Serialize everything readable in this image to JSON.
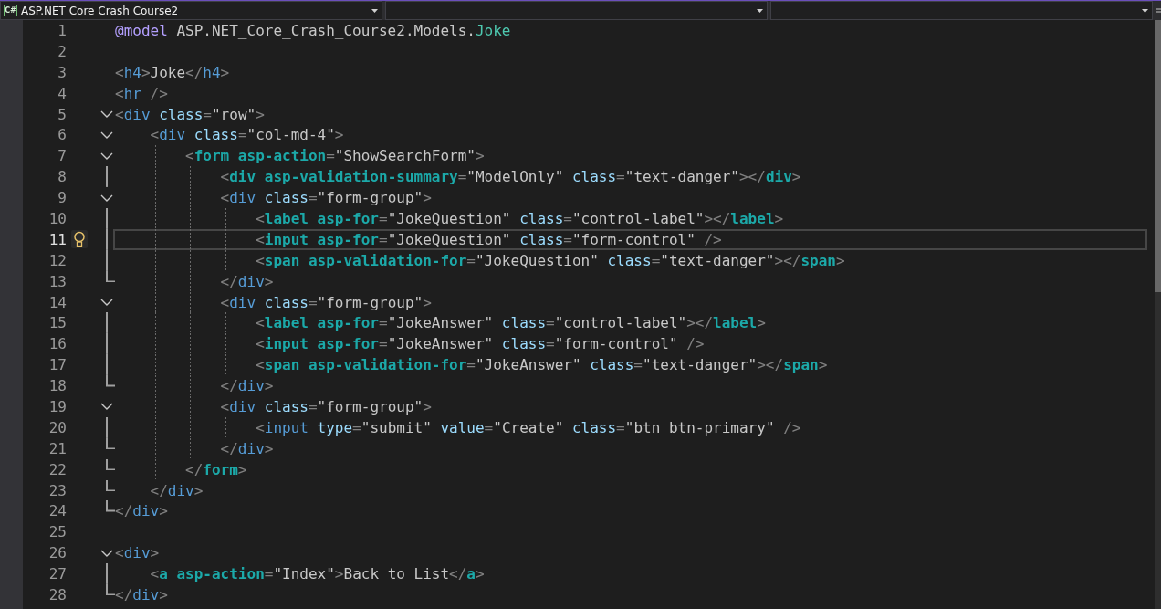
{
  "navbar": {
    "project_dropdown": {
      "icon_label": "C#",
      "text": "ASP.NET Core Crash Course2"
    }
  },
  "lines": [
    {
      "number": "1",
      "kind": "plain",
      "selected": false,
      "hint": false,
      "tokens": [
        {
          "kind": "k",
          "text": "@model"
        },
        {
          "kind": "v",
          "text": " ASP.NET_Core_Crash_Course2.Models."
        },
        {
          "kind": "y",
          "text": "Joke"
        }
      ]
    },
    {
      "number": "2",
      "kind": "plain",
      "selected": false,
      "hint": false
    },
    {
      "number": "3",
      "kind": "plain",
      "selected": false,
      "hint": false,
      "tokens": [
        {
          "kind": "p",
          "text": "<"
        },
        {
          "kind": "t",
          "text": "h4"
        },
        {
          "kind": "p",
          "text": ">"
        },
        {
          "kind": "v",
          "text": "Joke"
        },
        {
          "kind": "p",
          "text": "</"
        },
        {
          "kind": "t",
          "text": "h4"
        },
        {
          "kind": "p",
          "text": ">"
        }
      ]
    },
    {
      "number": "4",
      "kind": "plain",
      "selected": false,
      "hint": false,
      "tokens": [
        {
          "kind": "p",
          "text": "<"
        },
        {
          "kind": "t",
          "text": "hr"
        },
        {
          "kind": "p",
          "text": " />"
        }
      ]
    },
    {
      "number": "5",
      "kind": "opener",
      "selected": false,
      "hint": false,
      "tokens": [
        {
          "kind": "p",
          "text": "<"
        },
        {
          "kind": "t",
          "text": "div"
        },
        {
          "kind": "a",
          "text": " class"
        },
        {
          "kind": "p",
          "text": "="
        },
        {
          "kind": "v",
          "text": "\"row\""
        },
        {
          "kind": "p",
          "text": ">"
        }
      ]
    },
    {
      "number": "6",
      "kind": "opener",
      "selected": false,
      "hint": false,
      "tokens": [
        {
          "kind": "p",
          "text": "    <"
        },
        {
          "kind": "t",
          "text": "div"
        },
        {
          "kind": "a",
          "text": " class"
        },
        {
          "kind": "p",
          "text": "="
        },
        {
          "kind": "v",
          "text": "\"col-md-4\""
        },
        {
          "kind": "p",
          "text": ">"
        }
      ]
    },
    {
      "number": "7",
      "kind": "opener",
      "selected": false,
      "hint": false,
      "tokens": [
        {
          "kind": "p",
          "text": "        <"
        },
        {
          "kind": "h",
          "text": "form"
        },
        {
          "kind": "h",
          "text": " asp-action"
        },
        {
          "kind": "p",
          "text": "="
        },
        {
          "kind": "v",
          "text": "\"ShowSearchForm\""
        },
        {
          "kind": "p",
          "text": ">"
        }
      ]
    },
    {
      "number": "8",
      "kind": "inner",
      "selected": false,
      "hint": false,
      "tokens": [
        {
          "kind": "p",
          "text": "            <"
        },
        {
          "kind": "h",
          "text": "div"
        },
        {
          "kind": "h",
          "text": " asp-validation-summary"
        },
        {
          "kind": "p",
          "text": "="
        },
        {
          "kind": "v",
          "text": "\"ModelOnly\""
        },
        {
          "kind": "a",
          "text": " class"
        },
        {
          "kind": "p",
          "text": "="
        },
        {
          "kind": "v",
          "text": "\"text-danger\""
        },
        {
          "kind": "p",
          "text": "></"
        },
        {
          "kind": "h",
          "text": "div"
        },
        {
          "kind": "p",
          "text": ">"
        }
      ]
    },
    {
      "number": "9",
      "kind": "opener",
      "selected": false,
      "hint": false,
      "tokens": [
        {
          "kind": "p",
          "text": "            <"
        },
        {
          "kind": "t",
          "text": "div"
        },
        {
          "kind": "a",
          "text": " class"
        },
        {
          "kind": "p",
          "text": "="
        },
        {
          "kind": "v",
          "text": "\"form-group\""
        },
        {
          "kind": "p",
          "text": ">"
        }
      ]
    },
    {
      "number": "10",
      "kind": "inner",
      "selected": false,
      "hint": false,
      "tokens": [
        {
          "kind": "p",
          "text": "                <"
        },
        {
          "kind": "h",
          "text": "label"
        },
        {
          "kind": "h",
          "text": " asp-for"
        },
        {
          "kind": "p",
          "text": "="
        },
        {
          "kind": "v",
          "text": "\"JokeQuestion\""
        },
        {
          "kind": "a",
          "text": " class"
        },
        {
          "kind": "p",
          "text": "="
        },
        {
          "kind": "v",
          "text": "\"control-label\""
        },
        {
          "kind": "p",
          "text": "></"
        },
        {
          "kind": "h",
          "text": "label"
        },
        {
          "kind": "p",
          "text": ">"
        }
      ]
    },
    {
      "number": "11",
      "kind": "inner",
      "selected": true,
      "hint": true,
      "tokens": [
        {
          "kind": "p",
          "text": "                <"
        },
        {
          "kind": "h",
          "text": "input"
        },
        {
          "kind": "h",
          "text": " asp-for"
        },
        {
          "kind": "p",
          "text": "="
        },
        {
          "kind": "v",
          "text": "\"JokeQuestion\""
        },
        {
          "kind": "a",
          "text": " class"
        },
        {
          "kind": "p",
          "text": "="
        },
        {
          "kind": "v",
          "text": "\"form-control\""
        },
        {
          "kind": "p",
          "text": " />"
        }
      ]
    },
    {
      "number": "12",
      "kind": "inner",
      "selected": false,
      "hint": false,
      "tokens": [
        {
          "kind": "p",
          "text": "                <"
        },
        {
          "kind": "h",
          "text": "span"
        },
        {
          "kind": "h",
          "text": " asp-validation-for"
        },
        {
          "kind": "p",
          "text": "="
        },
        {
          "kind": "v",
          "text": "\"JokeQuestion\""
        },
        {
          "kind": "a",
          "text": " class"
        },
        {
          "kind": "p",
          "text": "="
        },
        {
          "kind": "v",
          "text": "\"text-danger\""
        },
        {
          "kind": "p",
          "text": "></"
        },
        {
          "kind": "h",
          "text": "span"
        },
        {
          "kind": "p",
          "text": ">"
        }
      ]
    },
    {
      "number": "13",
      "kind": "closer",
      "selected": false,
      "hint": false,
      "tokens": [
        {
          "kind": "p",
          "text": "            </"
        },
        {
          "kind": "t",
          "text": "div"
        },
        {
          "kind": "p",
          "text": ">"
        }
      ]
    },
    {
      "number": "14",
      "kind": "opener",
      "selected": false,
      "hint": false,
      "tokens": [
        {
          "kind": "p",
          "text": "            <"
        },
        {
          "kind": "t",
          "text": "div"
        },
        {
          "kind": "a",
          "text": " class"
        },
        {
          "kind": "p",
          "text": "="
        },
        {
          "kind": "v",
          "text": "\"form-group\""
        },
        {
          "kind": "p",
          "text": ">"
        }
      ]
    },
    {
      "number": "15",
      "kind": "inner",
      "selected": false,
      "hint": false,
      "tokens": [
        {
          "kind": "p",
          "text": "                <"
        },
        {
          "kind": "h",
          "text": "label"
        },
        {
          "kind": "h",
          "text": " asp-for"
        },
        {
          "kind": "p",
          "text": "="
        },
        {
          "kind": "v",
          "text": "\"JokeAnswer\""
        },
        {
          "kind": "a",
          "text": " class"
        },
        {
          "kind": "p",
          "text": "="
        },
        {
          "kind": "v",
          "text": "\"control-label\""
        },
        {
          "kind": "p",
          "text": "></"
        },
        {
          "kind": "h",
          "text": "label"
        },
        {
          "kind": "p",
          "text": ">"
        }
      ]
    },
    {
      "number": "16",
      "kind": "inner",
      "selected": false,
      "hint": false,
      "tokens": [
        {
          "kind": "p",
          "text": "                <"
        },
        {
          "kind": "h",
          "text": "input"
        },
        {
          "kind": "h",
          "text": " asp-for"
        },
        {
          "kind": "p",
          "text": "="
        },
        {
          "kind": "v",
          "text": "\"JokeAnswer\""
        },
        {
          "kind": "a",
          "text": " class"
        },
        {
          "kind": "p",
          "text": "="
        },
        {
          "kind": "v",
          "text": "\"form-control\""
        },
        {
          "kind": "p",
          "text": " />"
        }
      ]
    },
    {
      "number": "17",
      "kind": "inner",
      "selected": false,
      "hint": false,
      "tokens": [
        {
          "kind": "p",
          "text": "                <"
        },
        {
          "kind": "h",
          "text": "span"
        },
        {
          "kind": "h",
          "text": " asp-validation-for"
        },
        {
          "kind": "p",
          "text": "="
        },
        {
          "kind": "v",
          "text": "\"JokeAnswer\""
        },
        {
          "kind": "a",
          "text": " class"
        },
        {
          "kind": "p",
          "text": "="
        },
        {
          "kind": "v",
          "text": "\"text-danger\""
        },
        {
          "kind": "p",
          "text": "></"
        },
        {
          "kind": "h",
          "text": "span"
        },
        {
          "kind": "p",
          "text": ">"
        }
      ]
    },
    {
      "number": "18",
      "kind": "closer",
      "selected": false,
      "hint": false,
      "tokens": [
        {
          "kind": "p",
          "text": "            </"
        },
        {
          "kind": "t",
          "text": "div"
        },
        {
          "kind": "p",
          "text": ">"
        }
      ]
    },
    {
      "number": "19",
      "kind": "opener",
      "selected": false,
      "hint": false,
      "tokens": [
        {
          "kind": "p",
          "text": "            <"
        },
        {
          "kind": "t",
          "text": "div"
        },
        {
          "kind": "a",
          "text": " class"
        },
        {
          "kind": "p",
          "text": "="
        },
        {
          "kind": "v",
          "text": "\"form-group\""
        },
        {
          "kind": "p",
          "text": ">"
        }
      ]
    },
    {
      "number": "20",
      "kind": "inner",
      "selected": false,
      "hint": false,
      "tokens": [
        {
          "kind": "p",
          "text": "                <"
        },
        {
          "kind": "t",
          "text": "input"
        },
        {
          "kind": "a",
          "text": " type"
        },
        {
          "kind": "p",
          "text": "="
        },
        {
          "kind": "v",
          "text": "\"submit\""
        },
        {
          "kind": "a",
          "text": " value"
        },
        {
          "kind": "p",
          "text": "="
        },
        {
          "kind": "v",
          "text": "\"Create\""
        },
        {
          "kind": "a",
          "text": " class"
        },
        {
          "kind": "p",
          "text": "="
        },
        {
          "kind": "v",
          "text": "\"btn btn-primary\""
        },
        {
          "kind": "p",
          "text": " />"
        }
      ]
    },
    {
      "number": "21",
      "kind": "closer",
      "selected": false,
      "hint": false,
      "tokens": [
        {
          "kind": "p",
          "text": "            </"
        },
        {
          "kind": "t",
          "text": "div"
        },
        {
          "kind": "p",
          "text": ">"
        }
      ]
    },
    {
      "number": "22",
      "kind": "closer",
      "selected": false,
      "hint": false,
      "tokens": [
        {
          "kind": "p",
          "text": "        </"
        },
        {
          "kind": "h",
          "text": "form"
        },
        {
          "kind": "p",
          "text": ">"
        }
      ]
    },
    {
      "number": "23",
      "kind": "closer",
      "selected": false,
      "hint": false,
      "tokens": [
        {
          "kind": "p",
          "text": "    </"
        },
        {
          "kind": "t",
          "text": "div"
        },
        {
          "kind": "p",
          "text": ">"
        }
      ]
    },
    {
      "number": "24",
      "kind": "closer",
      "selected": false,
      "hint": false,
      "tokens": [
        {
          "kind": "p",
          "text": "</"
        },
        {
          "kind": "t",
          "text": "div"
        },
        {
          "kind": "p",
          "text": ">"
        }
      ]
    },
    {
      "number": "25",
      "kind": "plain",
      "selected": false,
      "hint": false
    },
    {
      "number": "26",
      "kind": "opener",
      "selected": false,
      "hint": false,
      "tokens": [
        {
          "kind": "p",
          "text": "<"
        },
        {
          "kind": "t",
          "text": "div"
        },
        {
          "kind": "p",
          "text": ">"
        }
      ]
    },
    {
      "number": "27",
      "kind": "inner",
      "selected": false,
      "hint": false,
      "tokens": [
        {
          "kind": "p",
          "text": "    <"
        },
        {
          "kind": "h",
          "text": "a"
        },
        {
          "kind": "h",
          "text": " asp-action"
        },
        {
          "kind": "p",
          "text": "="
        },
        {
          "kind": "v",
          "text": "\"Index\""
        },
        {
          "kind": "p",
          "text": ">"
        },
        {
          "kind": "v",
          "text": "Back to List"
        },
        {
          "kind": "p",
          "text": "</"
        },
        {
          "kind": "h",
          "text": "a"
        },
        {
          "kind": "p",
          "text": ">"
        }
      ]
    },
    {
      "number": "28",
      "kind": "closer",
      "selected": false,
      "hint": false,
      "tokens": [
        {
          "kind": "p",
          "text": "</"
        },
        {
          "kind": "t",
          "text": "div"
        },
        {
          "kind": "p",
          "text": ">"
        }
      ]
    }
  ]
}
